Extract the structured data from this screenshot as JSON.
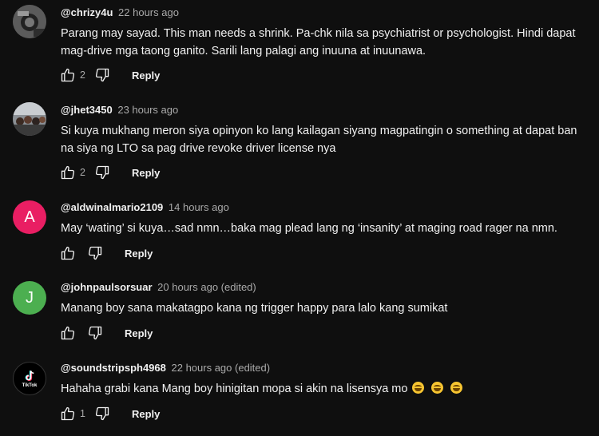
{
  "comments": [
    {
      "author": "@chrizy4u",
      "time": "22 hours ago",
      "text": "Parang may sayad. This man needs a shrink. Pa-chk nila sa psychiatrist or psychologist. Hindi dapat mag-drive mga taong ganito. Sarili lang palagi ang inuuna at inuunawa.",
      "likes": "2",
      "reply_label": "Reply"
    },
    {
      "author": "@jhet3450",
      "time": "23 hours ago",
      "text": "Si kuya mukhang meron siya opinyon ko lang kailagan siyang magpatingin o something at dapat ban na siya ng LTO sa pag drive revoke driver license nya",
      "likes": "2",
      "reply_label": "Reply"
    },
    {
      "author": "@aldwinalmario2109",
      "time": "14 hours ago",
      "text": "May ‘wating’ si kuya…sad nmn…baka mag plead lang ng ‘insanity’ at maging road rager na nmn.",
      "avatar_letter": "A",
      "avatar_color": "#e91e63",
      "reply_label": "Reply"
    },
    {
      "author": "@johnpaulsorsuar",
      "time": "20 hours ago (edited)",
      "text": "Manang boy sana makatagpo kana ng trigger happy para lalo kang sumikat",
      "avatar_letter": "J",
      "avatar_color": "#4caf50",
      "reply_label": "Reply"
    },
    {
      "author": "@soundstripsph4968",
      "time": "22 hours ago (edited)",
      "text": "Hahaha grabi kana Mang boy hinigitan mopa si akin na lisensya mo",
      "likes": "1",
      "avatar_text": "TikTok",
      "reply_label": "Reply"
    }
  ],
  "colors": {
    "background": "#0f0f0f",
    "text": "#f1f1f1",
    "muted": "#aaaaaa"
  }
}
